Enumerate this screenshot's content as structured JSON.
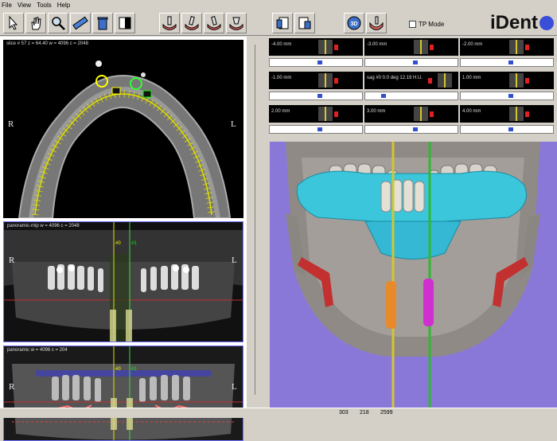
{
  "menu": {
    "file": "File",
    "view": "View",
    "tools": "Tools",
    "help": "Help"
  },
  "toolbar": {
    "tp_mode_label": "TP Mode",
    "btn_3d": "3D"
  },
  "logo": {
    "text": "iDent"
  },
  "axial": {
    "header": "slice # 57  z = 64.40  w = 4096  c = 2048",
    "r": "R",
    "l": "L",
    "marker1": "#0",
    "marker2": "#1"
  },
  "pano1": {
    "header": "panoramic-mip  w = 4096  c = 2048",
    "r": "R",
    "l": "L",
    "marker1": "#0",
    "marker2": "#1"
  },
  "pano2": {
    "header": "panoramic  w = 4096  c = 204",
    "r": "R",
    "l": "L",
    "marker1": "#0",
    "marker2": "#1"
  },
  "slices": [
    {
      "label": "-4.00 mm"
    },
    {
      "label": "-3.00 mm"
    },
    {
      "label": "-2.00 mm"
    },
    {
      "label": "-1.00 mm"
    },
    {
      "label": "sag #0   0.0 deg  12.19 H.U."
    },
    {
      "label": "1.00 mm"
    },
    {
      "label": "2.00 mm"
    },
    {
      "label": "3.00 mm"
    },
    {
      "label": "4.00 mm"
    }
  ],
  "status": {
    "v1": "303",
    "v2": "218",
    "v3": "2599"
  }
}
